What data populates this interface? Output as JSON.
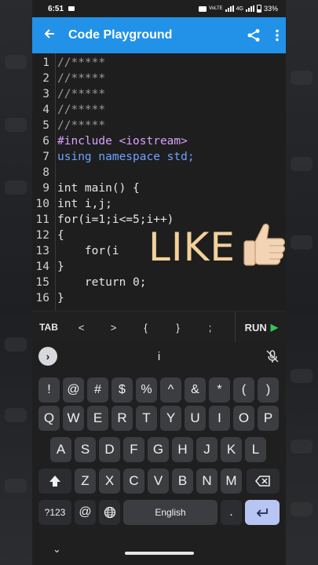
{
  "status_bar": {
    "time": "6:51",
    "network": "4G",
    "volte": "VoLTE",
    "battery": "33%"
  },
  "app_bar": {
    "title": "Code Playground"
  },
  "editor": {
    "line_numbers": [
      "1",
      "2",
      "3",
      "4",
      "5",
      "6",
      "7",
      "8",
      "9",
      "10",
      "11",
      "12",
      "13",
      "14",
      "15",
      "16"
    ],
    "lines": [
      "//*****",
      "//*****",
      "//*****",
      "//*****",
      "//*****",
      "#include <iostream>",
      "using namespace std;",
      "",
      "int main() {",
      "int i,j;",
      "for(i=1;i<=5;i++)",
      "{",
      "    for(i",
      "}",
      "    return 0;",
      "}"
    ]
  },
  "overlay": {
    "text": "LIKE",
    "emoji_name": "thumbs-up-icon"
  },
  "symbol_bar": {
    "tab": "TAB",
    "symbols": [
      "<",
      ">",
      "{",
      "}",
      ";"
    ],
    "run": "RUN"
  },
  "keyboard": {
    "suggestion": "i",
    "row1": [
      "!",
      "@",
      "#",
      "$",
      "%",
      "^",
      "&",
      "*",
      "(",
      ")"
    ],
    "row2": [
      "Q",
      "W",
      "E",
      "R",
      "T",
      "Y",
      "U",
      "I",
      "O",
      "P"
    ],
    "row3": [
      "A",
      "S",
      "D",
      "F",
      "G",
      "H",
      "J",
      "K",
      "L"
    ],
    "row4": [
      "Z",
      "X",
      "C",
      "V",
      "B",
      "N",
      "M"
    ],
    "row5": {
      "symbols": "?123",
      "at": "@",
      "space": "English",
      "dot": "."
    }
  },
  "colors": {
    "app_bar": "#2291e8",
    "run_play": "#34c759",
    "enter_key": "#b7c5f2",
    "overlay": "#f3d19a"
  }
}
